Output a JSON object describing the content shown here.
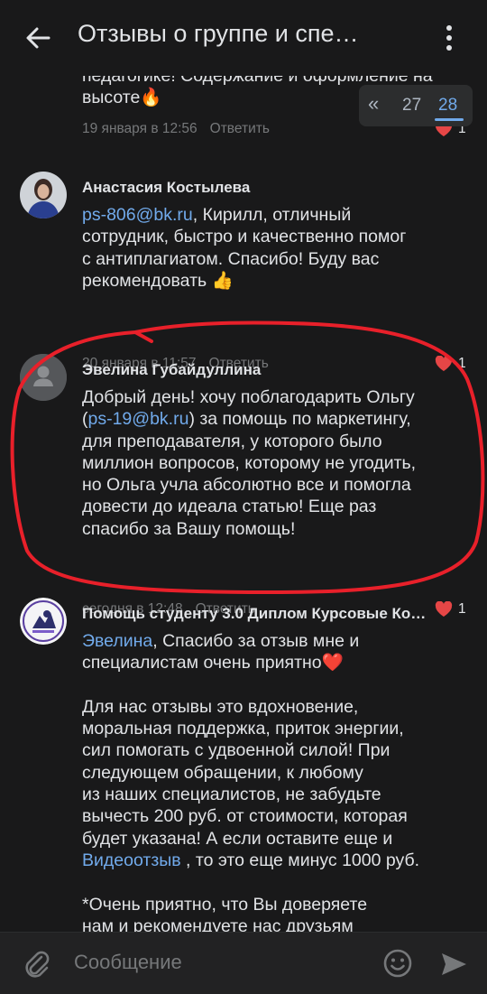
{
  "header": {
    "title": "Отзывы о группе и спе…"
  },
  "pager": {
    "prev": "«",
    "page_a": "27",
    "page_b": "28"
  },
  "comments": [
    {
      "author": "",
      "lines": [
        "педагогике! Содержание и оформление на",
        "высоте🔥"
      ],
      "time": "19 января в 12:56",
      "reply": "Ответить",
      "likes": "1"
    },
    {
      "author": "Анастасия Костылева",
      "lines": [
        "ps-806@bk.ru",
        ", Кирилл, отличный",
        "сотрудник, быстро и качественно помог",
        "с антиплагиатом. Спасибо! Буду вас",
        "рекомендовать 👍"
      ],
      "time": "20 января в 11:57",
      "reply": "Ответить",
      "likes": "1"
    },
    {
      "author": "Эвелина Губайдуллина",
      "lines": [
        "Добрый день! хочу поблагодарить Ольгу",
        "(",
        "ps-19@bk.ru",
        ") за помощь по маркетингу,",
        "для преподавателя, у которого было",
        "миллион вопросов, которому не угодить,",
        "но Ольга учла абсолютно все и помогла",
        "довести до идеала статью! Еще раз",
        "спасибо за Вашу помощь!"
      ],
      "time": "сегодня в 12:48",
      "reply": "Ответить",
      "likes": "1"
    },
    {
      "author": "Помощь студенту 3.0 Диплом Курсовые Ко…",
      "lines": [
        "Эвелина",
        ", Спасибо за отзыв мне и",
        "специалистам очень приятно❤️",
        "Для нас отзывы это вдохновение,",
        "моральная поддержка, приток энергии,",
        "сил помогать с удвоенной силой! При",
        "следующем обращении, к любому",
        "из наших специалистов, не забудьте",
        "вычесть 200 руб. от стоимости, которая",
        "будет указана! А если оставите еще и",
        "Видеоотзыв",
        " , то это еще минус 1000 руб.",
        "*Очень приятно, что Вы доверяете",
        "нам и рекомендуете нас друзьям"
      ]
    }
  ],
  "composer": {
    "placeholder": "Сообщение"
  },
  "colors": {
    "background": "#19191a",
    "link": "#71aaeb",
    "like_heart": "#e64646",
    "highlight_stroke": "#e8202a"
  }
}
